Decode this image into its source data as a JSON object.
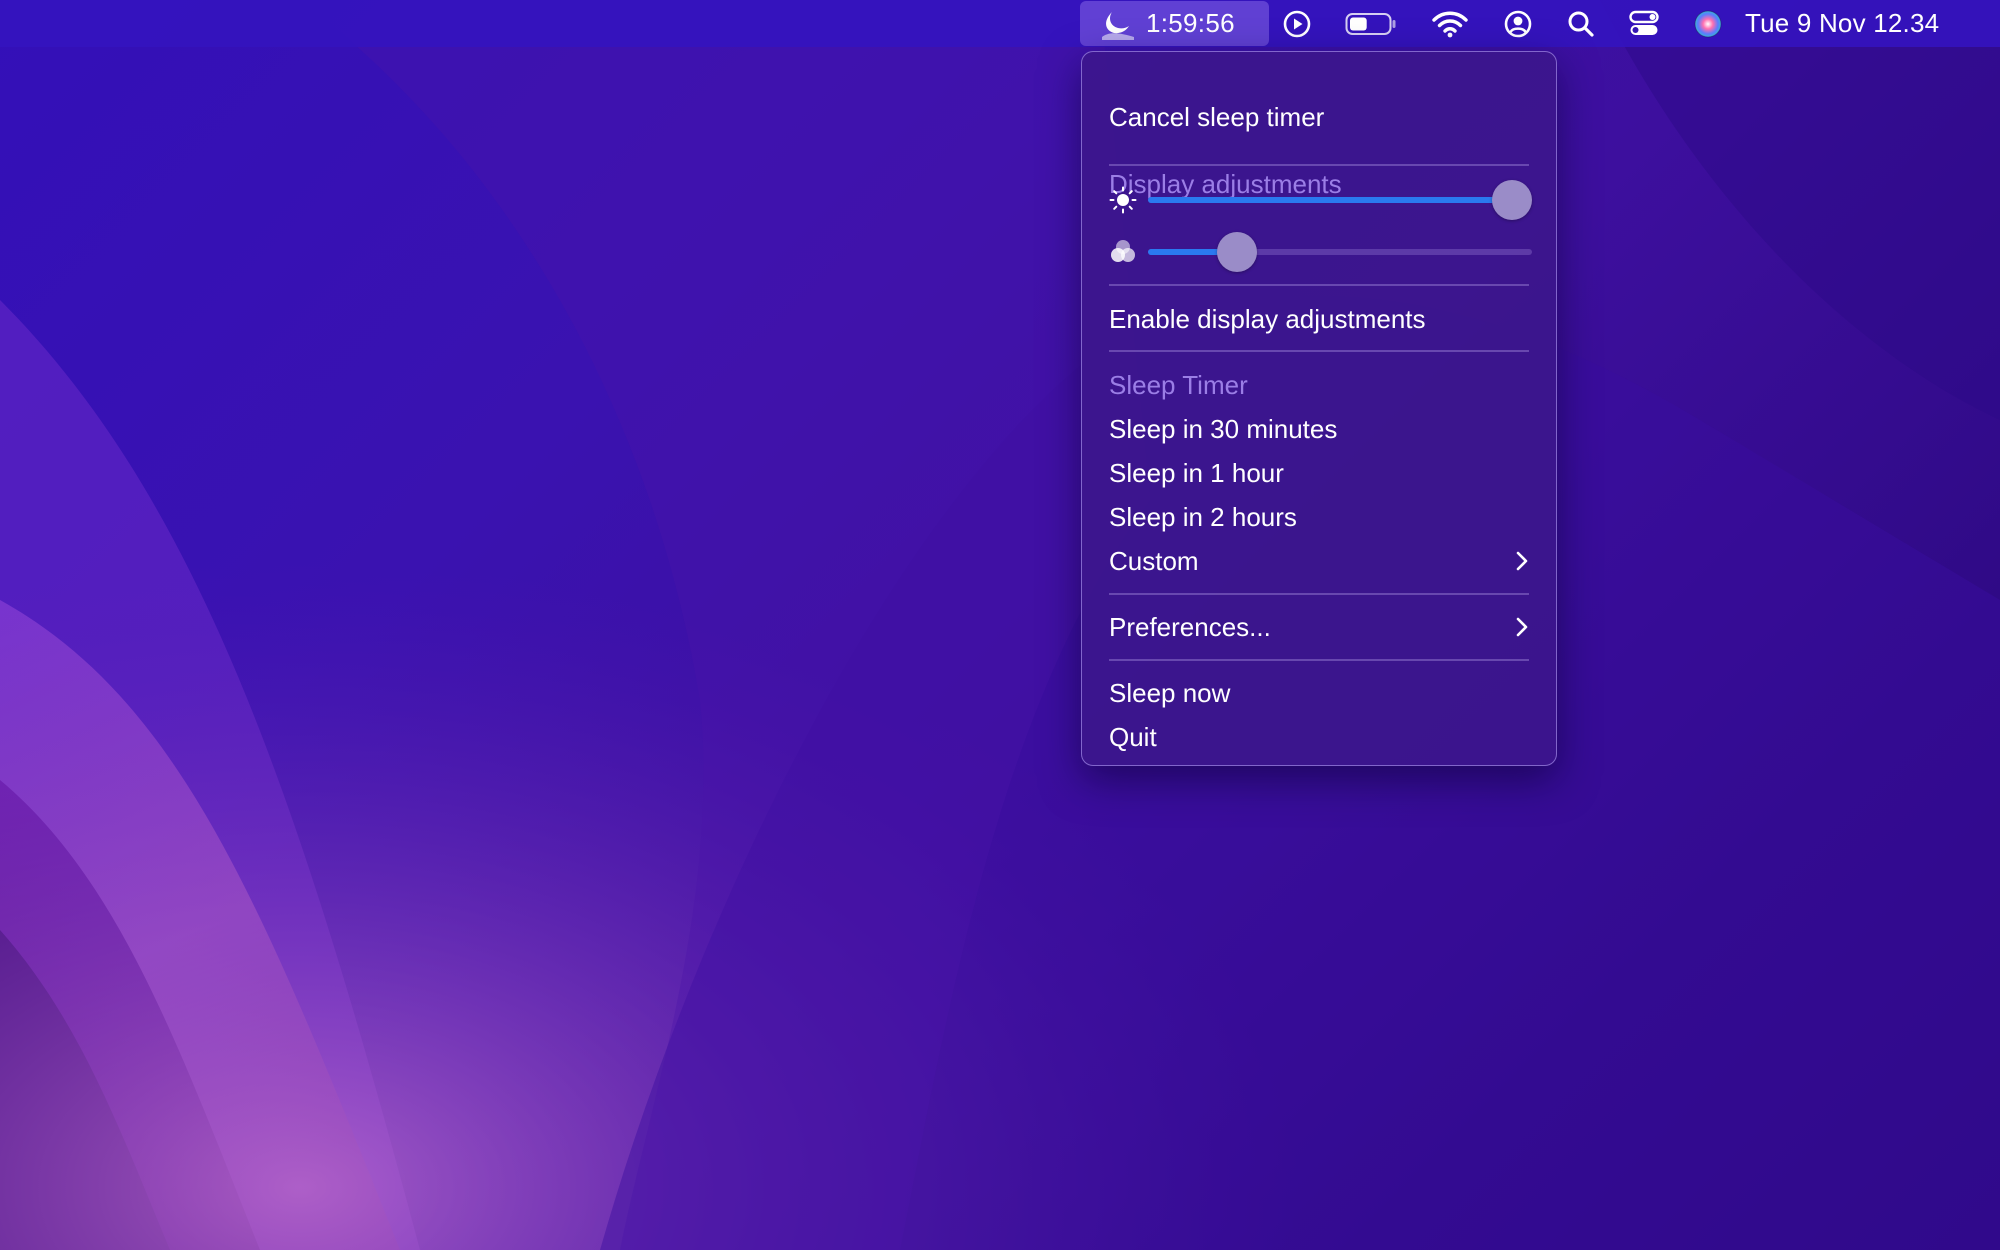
{
  "menubar": {
    "sleep_timer_countdown": "1:59:56",
    "datetime": "Tue 9 Nov  12.34",
    "icons": [
      "moon-icon",
      "play-circle-icon",
      "battery-icon",
      "wifi-icon",
      "user-circle-icon",
      "search-icon",
      "control-center-icon",
      "siri-icon"
    ],
    "battery_level": 0.45
  },
  "menu": {
    "cancel_label": "Cancel sleep timer",
    "display_header": "Display adjustments",
    "brightness_value": 1.0,
    "color_value": 0.2,
    "enable_display_label": "Enable display adjustments",
    "sleep_header": "Sleep Timer",
    "sleep_30": "Sleep in 30 minutes",
    "sleep_1h": "Sleep in 1 hour",
    "sleep_2h": "Sleep in 2 hours",
    "custom_label": "Custom",
    "preferences_label": "Preferences...",
    "sleep_now_label": "Sleep now",
    "quit_label": "Quit"
  },
  "colors": {
    "accent_blue": "#2a79f0",
    "header_purple": "#9b7ee6"
  }
}
